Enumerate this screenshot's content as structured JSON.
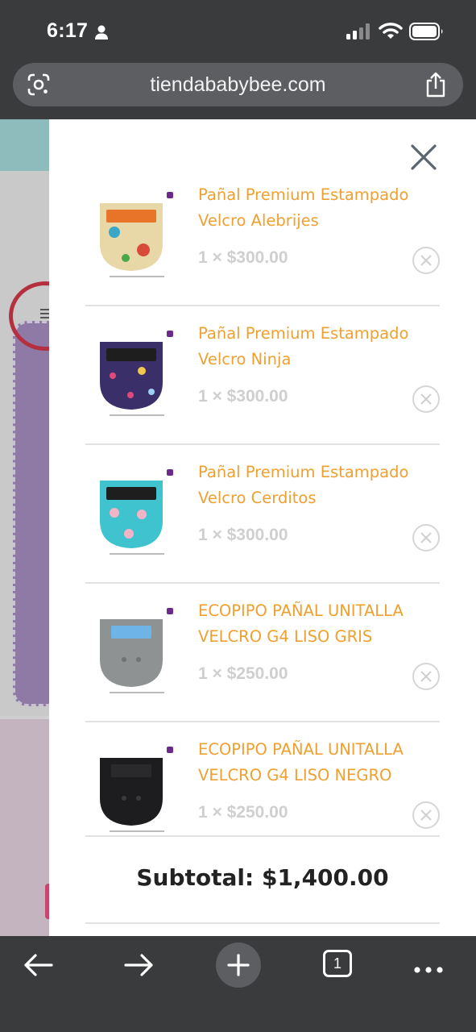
{
  "status_bar": {
    "time": "6:17"
  },
  "browser": {
    "url": "tiendababybee.com",
    "tabs_count": "1"
  },
  "cart": {
    "items": [
      {
        "name": "Pañal Premium Estampado Velcro Alebrijes",
        "quantity_price": "1 × $300.00",
        "thumb_color": "#e8d8a8",
        "tab_color": "#e8742a"
      },
      {
        "name": "Pañal Premium Estampado Velcro Ninja",
        "quantity_price": "1 × $300.00",
        "thumb_color": "#3b2f6a",
        "tab_color": "#1e1e1e"
      },
      {
        "name": "Pañal Premium Estampado Velcro Cerditos",
        "quantity_price": "1 × $300.00",
        "thumb_color": "#3fc3cf",
        "tab_color": "#1e1e1e"
      },
      {
        "name": "ECOPIPO PAÑAL UNITALLA VELCRO G4 LISO GRIS",
        "quantity_price": "1 × $250.00",
        "thumb_color": "#8e9293",
        "tab_color": "#6fb4e6"
      },
      {
        "name": "ECOPIPO PAÑAL UNITALLA VELCRO G4 LISO NEGRO",
        "quantity_price": "1 × $250.00",
        "thumb_color": "#1d1d1f",
        "tab_color": "#2a2a2c"
      }
    ],
    "subtotal": "Subtotal: $1,400.00"
  },
  "colors": {
    "accent": "#f0a030",
    "browser_chrome": "#3a3b3d",
    "url_bar": "#5d5e61"
  }
}
